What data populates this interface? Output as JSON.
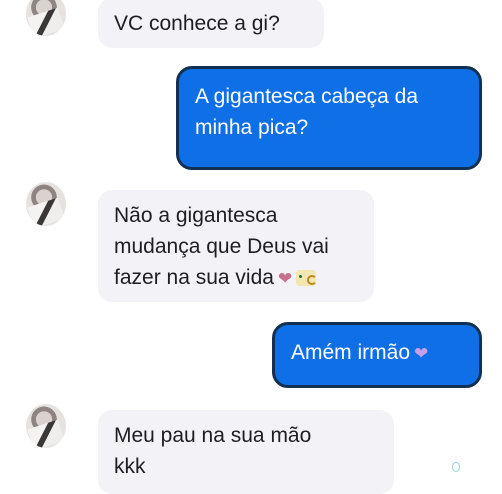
{
  "messages": [
    {
      "side": "incoming",
      "lines": [
        "VC conhece a gi?"
      ]
    },
    {
      "side": "outgoing",
      "lines": [
        "A gigantesca cabeça da",
        "minha pica?"
      ]
    },
    {
      "side": "incoming",
      "lines": [
        "Não a gigantesca",
        "mudança  que Deus vai",
        "fazer  na sua vida"
      ],
      "emoji": [
        "heart-icon",
        "smile-icon"
      ]
    },
    {
      "side": "outgoing",
      "lines": [
        "Amém irmão"
      ],
      "emoji": [
        "heart-icon"
      ]
    },
    {
      "side": "incoming",
      "lines": [
        "Meu pau na sua mão",
        "kkk"
      ]
    }
  ],
  "colors": {
    "outgoing_bubble": "#0f6fe6",
    "outgoing_border": "#123052",
    "incoming_bubble": "#f3f2f6",
    "heart": "#c6708d"
  }
}
